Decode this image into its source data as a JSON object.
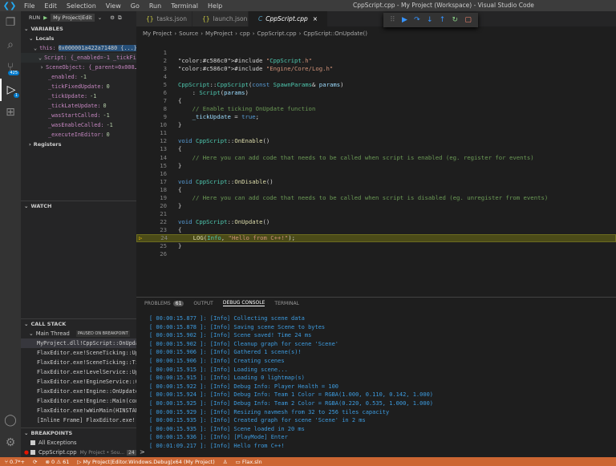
{
  "window": {
    "title": "CppScript.cpp - My Project (Workspace) - Visual Studio Code"
  },
  "menu": [
    "File",
    "Edit",
    "Selection",
    "View",
    "Go",
    "Run",
    "Terminal",
    "Help"
  ],
  "activity": {
    "scm_badge": "425",
    "debug_badge": "1"
  },
  "run": {
    "label": "RUN",
    "config": "My Project|Edit"
  },
  "variables": {
    "title": "VARIABLES",
    "locals": "Locals",
    "this_name": "this:",
    "this_val": "0x000001a422a71480 {...}",
    "script": "Script: {_enabled=-1 _tickFi…",
    "sceneobject": "SceneObject: {_parent=0x000…",
    "fields": [
      {
        "n": "_enabled:",
        "v": "-1"
      },
      {
        "n": "_tickFixedUpdate:",
        "v": "0"
      },
      {
        "n": "_tickUpdate:",
        "v": "-1"
      },
      {
        "n": "_tickLateUpdate:",
        "v": "0"
      },
      {
        "n": "_wasStartCalled:",
        "v": "-1"
      },
      {
        "n": "_wasEnableCalled:",
        "v": "-1"
      },
      {
        "n": "_executeInEditor:",
        "v": "0"
      }
    ],
    "registers": "Registers"
  },
  "watch": {
    "title": "WATCH"
  },
  "callstack": {
    "title": "CALL STACK",
    "thread": "Main Thread",
    "status": "PAUSED ON BREAKPOINT",
    "frames": [
      "MyProject.dll!CppScript::OnUpdate",
      "FlaxEditor.exe!SceneTicking::Update",
      "FlaxEditor.exe!SceneTicking::Tick",
      "FlaxEditor.exe!LevelService::Update",
      "FlaxEditor.exe!EngineService::OnUpdate",
      "FlaxEditor.exe!Engine::OnUpdate",
      "FlaxEditor.exe!Engine::Main(const",
      "FlaxEditor.exe!wWinMain(HINSTANCE",
      "[Inline Frame] FlaxEditor.exe!"
    ]
  },
  "breakpoints": {
    "title": "BREAKPOINTS",
    "items": [
      {
        "label": "All Exceptions",
        "path": "",
        "line": ""
      },
      {
        "label": "CppScript.cpp",
        "path": "My Project • Sou...",
        "line": "24"
      }
    ]
  },
  "tabs": [
    {
      "label": "tasks.json",
      "icon": "{}"
    },
    {
      "label": "launch.json",
      "icon": "{}"
    },
    {
      "label": "CppScript.cpp",
      "icon": "C"
    }
  ],
  "breadcrumb": [
    "My Project",
    "Source",
    "MyProject",
    "cpp",
    "CppScript.cpp",
    "CppScript::OnUpdate()"
  ],
  "code": [
    "",
    "#include \"CppScript.h\"",
    "#include \"Engine/Core/Log.h\"",
    "",
    "CppScript::CppScript(const SpawnParams& params)",
    "    : Script(params)",
    "{",
    "    // Enable ticking OnUpdate function",
    "    _tickUpdate = true;",
    "}",
    "",
    "void CppScript::OnEnable()",
    "{",
    "    // Here you can add code that needs to be called when script is enabled (eg. register for events)",
    "}",
    "",
    "void CppScript::OnDisable()",
    "{",
    "    // Here you can add code that needs to be called when script is disabled (eg. unregister from events)",
    "}",
    "",
    "void CppScript::OnUpdate()",
    "{",
    "    LOG(Info, \"Hello from C++!\");",
    "}",
    ""
  ],
  "current_line": 24,
  "panel": {
    "tabs": [
      "PROBLEMS",
      "OUTPUT",
      "DEBUG CONSOLE",
      "TERMINAL"
    ],
    "problems_count": "61",
    "console": [
      "[ 00:00:15.877 ]: [Info] Collecting scene data",
      "[ 00:00:15.878 ]: [Info] Saving scene Scene to bytes",
      "[ 00:00:15.902 ]: [Info] Scene saved! Time 24 ms",
      "[ 00:00:15.902 ]: [Info] Cleanup graph for scene 'Scene'",
      "[ 00:00:15.906 ]: [Info] Gathered 1 scene(s)!",
      "[ 00:00:15.906 ]: [Info] Creating scenes",
      "[ 00:00:15.915 ]: [Info] Loading scene...",
      "[ 00:00:15.915 ]: [Info] Loading 0 lightmap(s)",
      "[ 00:00:15.922 ]: [Info] Debug Info: Player Health = 100",
      "[ 00:00:15.924 ]: [Info] Debug Info: Team 1 Color = RGBA(1.000, 0.110, 0.142, 1.000)",
      "[ 00:00:15.925 ]: [Info] Debug Info: Team 2 Color = RGBA(0.220, 0.535, 1.000, 1.000)",
      "[ 00:00:15.929 ]: [Info] Resizing navmesh from 32 to 256 tiles capacity",
      "[ 00:00:15.935 ]: [Info] Created graph for scene 'Scene' in 2 ms",
      "[ 00:00:15.935 ]: [Info] Scene loaded in 20 ms",
      "[ 00:00:15.936 ]: [Info] [PlayMode] Enter",
      "[ 00:01:09.217 ]: [Info] Hello from C++!"
    ],
    "prompt": ">"
  },
  "status": {
    "branch": "0.7*+",
    "errors": "0",
    "warnings": "61",
    "debug": "My Project|Editor.Windows.Debug|x64 (My Project)",
    "sln": "Flax.sln"
  },
  "colors": {
    "statusbar": "#cc6633",
    "accent": "#007acc"
  }
}
